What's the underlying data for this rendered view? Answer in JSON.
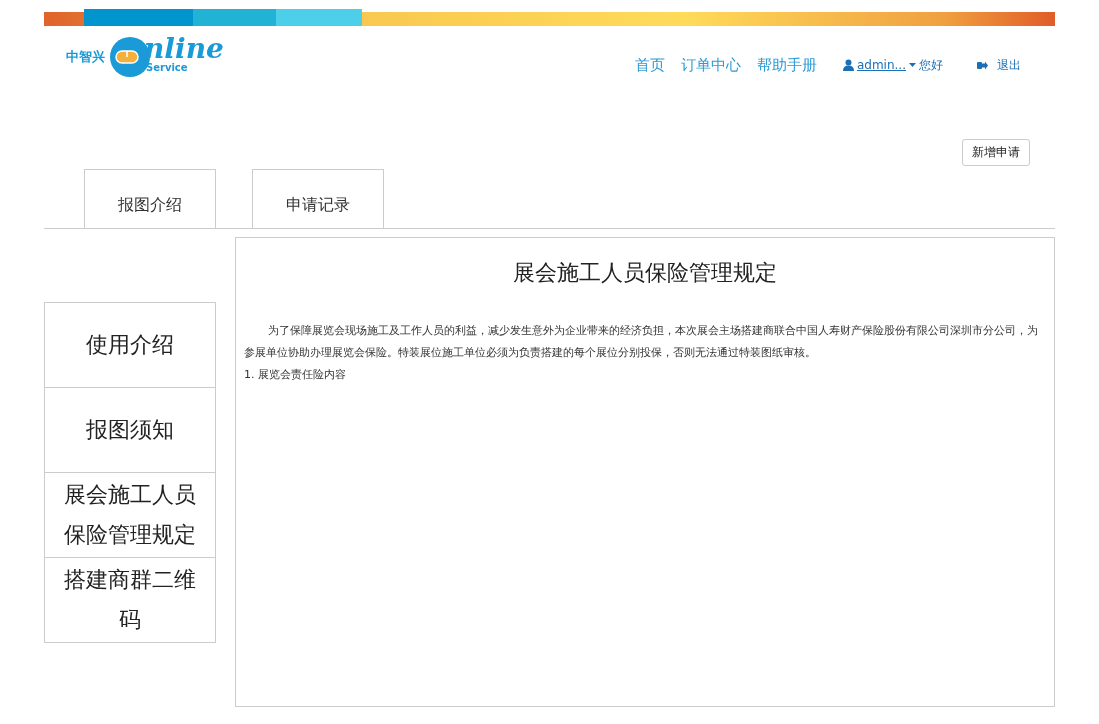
{
  "logo": {
    "brand": "中智兴",
    "word": "nline",
    "tagline": "Service"
  },
  "nav": {
    "links": [
      "首页",
      "订单中心",
      "帮助手册"
    ],
    "user": "admin...",
    "greeting": "您好",
    "logout": "退出"
  },
  "new_button": "新增申请",
  "tabs": [
    {
      "label": "报图介绍"
    },
    {
      "label": "申请记录"
    }
  ],
  "sidebar": {
    "items": [
      "使用介绍",
      "报图须知",
      "展会施工人员保险管理规定",
      "搭建商群二维码"
    ]
  },
  "article": {
    "title": "展会施工人员保险管理规定",
    "paragraphs": [
      "为了保障展览会现场施工及工作人员的利益，减少发生意外为企业带来的经济负担，本次展会主场搭建商联合中国人寿财产保险股份有限公司深圳市分公司，为参展单位协助办理展览会保险。特装展位施工单位必须为负责搭建的每个展位分别投保，否则无法通过特装图纸审核。"
    ],
    "items": [
      "1. 展览会责任险内容"
    ]
  }
}
